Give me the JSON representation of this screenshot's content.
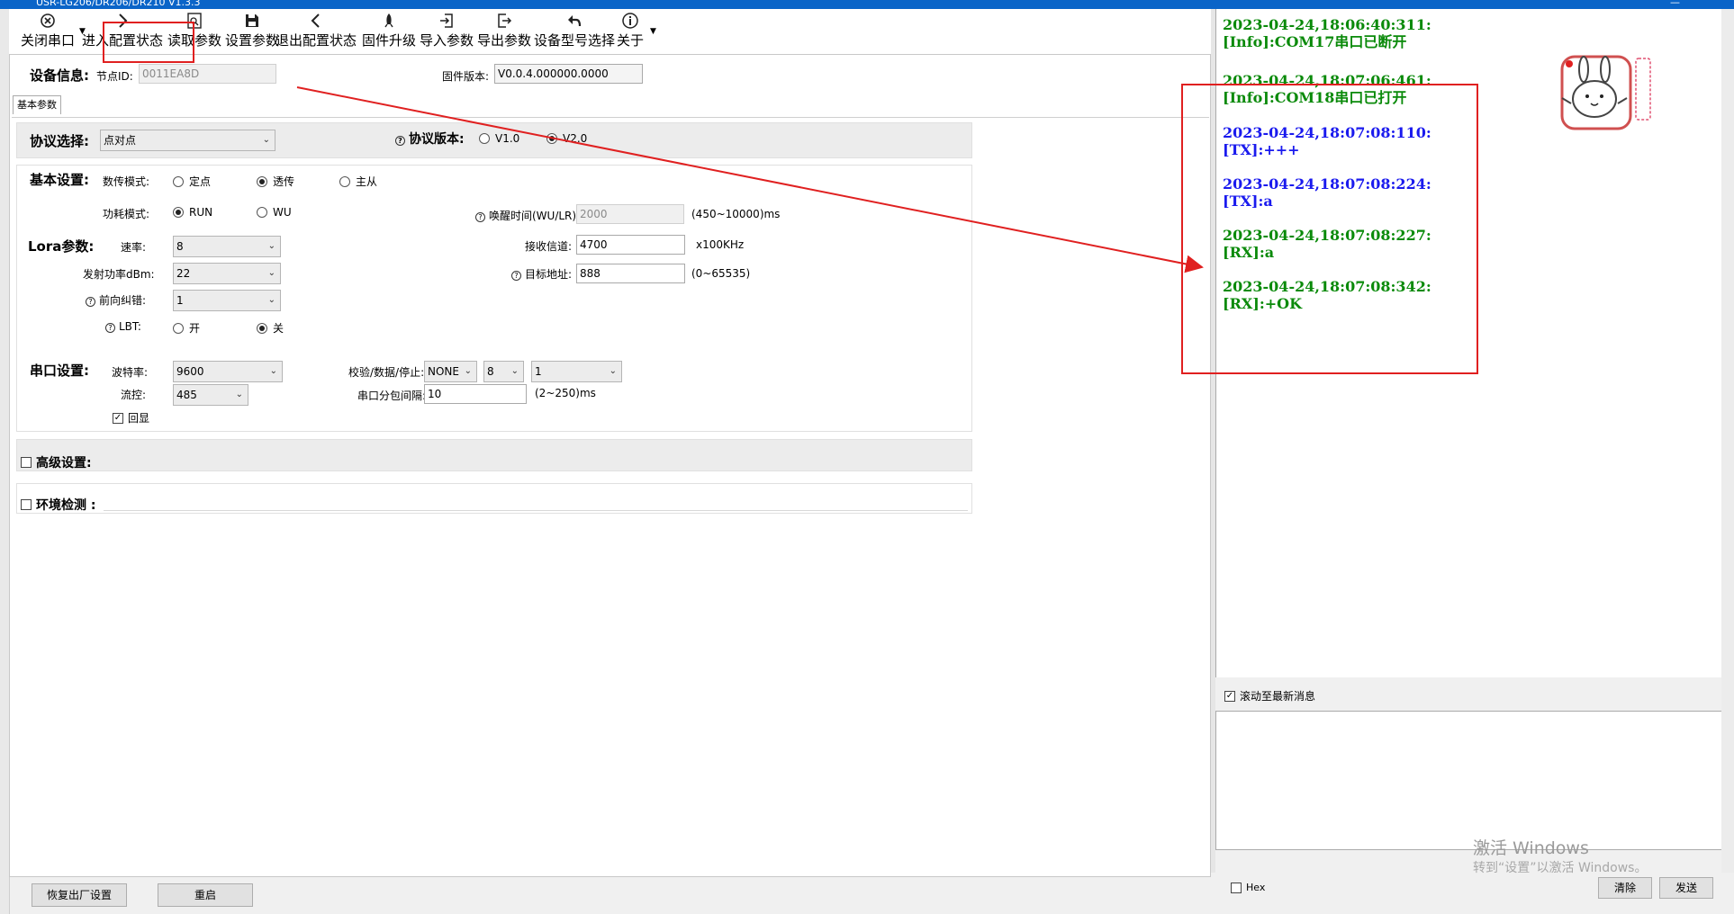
{
  "window": {
    "title": "USR-LG206/DR206/DR210 V1.3.3"
  },
  "toolbar": {
    "items": [
      {
        "label": "关闭串口",
        "icon": "close-circle-icon"
      },
      {
        "label": "进入配置状态",
        "icon": "arrow-right-icon"
      },
      {
        "label": "读取参数",
        "icon": "read-doc-icon"
      },
      {
        "label": "设置参数",
        "icon": "save-icon"
      },
      {
        "label": "退出配置状态",
        "icon": "arrow-left-icon"
      },
      {
        "label": "固件升级",
        "icon": "rocket-icon"
      },
      {
        "label": "导入参数",
        "icon": "import-icon"
      },
      {
        "label": "导出参数",
        "icon": "export-icon"
      },
      {
        "label": "设备型号选择",
        "icon": "undo-icon"
      },
      {
        "label": "关于",
        "icon": "info-icon"
      }
    ]
  },
  "device": {
    "header": "设备信息:",
    "node_label": "节点ID:",
    "node_value": "0011EA8D",
    "fw_label": "固件版本:",
    "fw_value": "V0.0.4.000000.0000"
  },
  "tab": {
    "label": "基本参数"
  },
  "protocol": {
    "header": "协议选择:",
    "value": "点对点",
    "ver_label": "协议版本:",
    "v1": "V1.0",
    "v2": "V2.0"
  },
  "basic": {
    "header": "基本设置:",
    "mode_label": "数传模式:",
    "mode_opts": [
      "定点",
      "透传",
      "主从"
    ],
    "power_label": "功耗模式:",
    "power_opts": [
      "RUN",
      "WU"
    ],
    "wake_label": "唤醒时间(WU/LR):",
    "wake_value": "2000",
    "wake_range": "(450~10000)ms"
  },
  "lora": {
    "header": "Lora参数:",
    "rate_label": "速率:",
    "rate_value": "8",
    "txp_label": "发射功率dBm:",
    "txp_value": "22",
    "fec_label": "前向纠错:",
    "fec_value": "1",
    "lbt_label": "LBT:",
    "lbt_on": "开",
    "lbt_off": "关",
    "ch_label": "接收信道:",
    "ch_value": "4700",
    "ch_unit": "x100KHz",
    "addr_label": "目标地址:",
    "addr_value": "888",
    "addr_range": "(0~65535)"
  },
  "serial": {
    "header": "串口设置:",
    "baud_label": "波特率:",
    "baud_value": "9600",
    "flow_label": "流控:",
    "flow_value": "485",
    "echo_label": "回显",
    "parity_label": "校验/数据/停止:",
    "parity": "NONE",
    "data": "8",
    "stop": "1",
    "gap_label": "串口分包间隔:",
    "gap_value": "10",
    "gap_range": "(2~250)ms"
  },
  "advanced": {
    "label": "高级设置:"
  },
  "env": {
    "label": "环境检测 :"
  },
  "bottom": {
    "factory": "恢复出厂设置",
    "reboot": "重启"
  },
  "log": {
    "entries": [
      {
        "time": "2023-04-24,18:06:40:311:",
        "msg": "[Info]:COM17串口已断开",
        "color": "#0a8a0a"
      },
      {
        "time": "2023-04-24,18:07:06:461:",
        "msg": "[Info]:COM18串口已打开",
        "color": "#0a8a0a"
      },
      {
        "time": "2023-04-24,18:07:08:110:",
        "msg": "[TX]:+++",
        "color": "#1a1aee"
      },
      {
        "time": "2023-04-24,18:07:08:224:",
        "msg": "[TX]:a",
        "color": "#1a1aee"
      },
      {
        "time": "2023-04-24,18:07:08:227:",
        "msg": "[RX]:a",
        "color": "#0a8a0a"
      },
      {
        "time": "2023-04-24,18:07:08:342:",
        "msg": "[RX]:+OK",
        "color": "#0a8a0a"
      }
    ],
    "scroll_label": "滚动至最新消息"
  },
  "send": {
    "hex_label": "Hex",
    "clear": "清除",
    "send": "发送"
  },
  "watermark": {
    "line1": "激活 Windows",
    "line2": "转到“设置”以激活 Windows。"
  },
  "colors": {
    "accent": "#0a64c8",
    "annotation": "#e02020"
  }
}
